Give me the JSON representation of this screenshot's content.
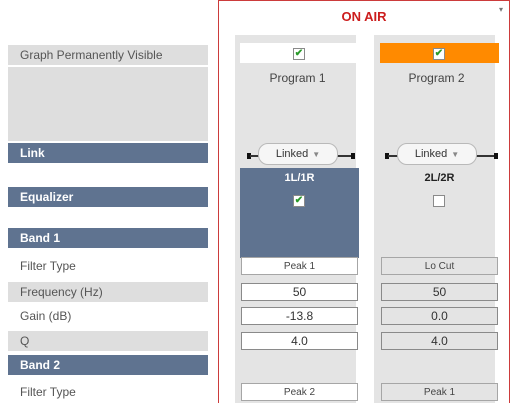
{
  "labels": {
    "graph_visible": "Graph Permanently Visible",
    "link": "Link",
    "equalizer": "Equalizer",
    "band1": "Band 1",
    "filter_type_1": "Filter Type",
    "frequency": "Frequency (Hz)",
    "gain": "Gain (dB)",
    "q": "Q",
    "band2": "Band 2",
    "filter_type_2": "Filter Type"
  },
  "panel": {
    "title": "ON AIR",
    "corner_glyph": "▾"
  },
  "programs": [
    {
      "name": "Program 1",
      "graph_visible": true,
      "link_label": "Linked",
      "channel": "1L/1R",
      "equalizer_enabled": true,
      "band1": {
        "filter_type": "Peak 1",
        "frequency": "50",
        "gain": "-13.8",
        "q": "4.0"
      },
      "band2": {
        "filter_type": "Peak 2"
      }
    },
    {
      "name": "Program 2",
      "graph_visible": true,
      "link_label": "Linked",
      "channel": "2L/2R",
      "equalizer_enabled": false,
      "band1": {
        "filter_type": "Lo Cut",
        "frequency": "50",
        "gain": "0.0",
        "q": "4.0"
      },
      "band2": {
        "filter_type": "Peak 1"
      }
    }
  ],
  "glyphs": {
    "check": "✔",
    "dropdown_arrow": "▼"
  },
  "colors": {
    "on_air_red": "#cc1d1d",
    "header_blue": "#5f7390",
    "program2_highlight": "#ff8a00",
    "row_gray": "#dedede",
    "column_gray": "#e4e4e4"
  }
}
